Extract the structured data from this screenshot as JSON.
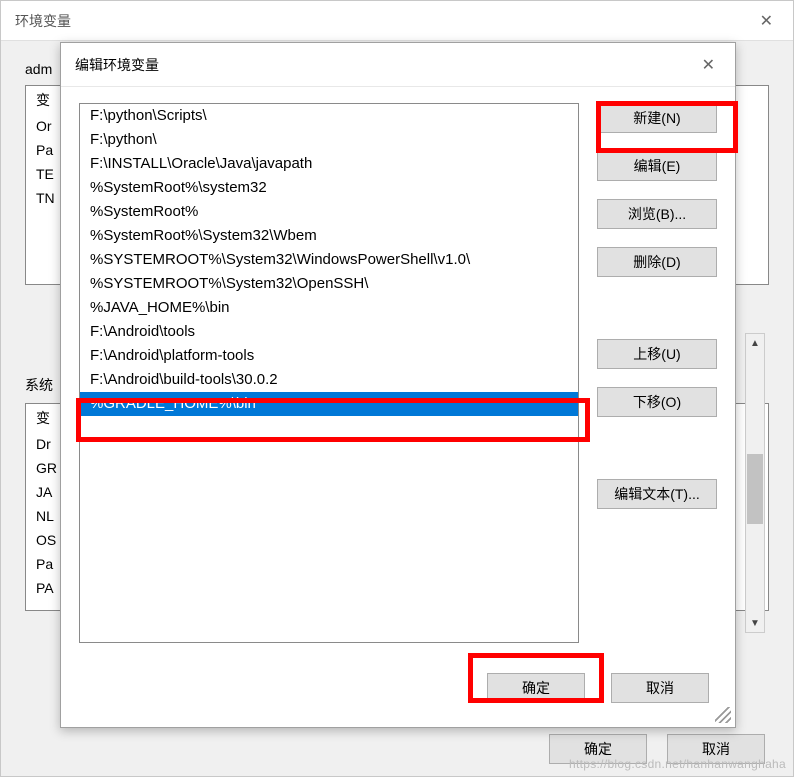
{
  "outer": {
    "title": "环境变量",
    "user_label": "adm",
    "sys_label": "系统",
    "user_vars_visible": [
      "变",
      "Or",
      "Pa",
      "TE",
      "TN"
    ],
    "sys_vars_visible": [
      "变",
      "Dr",
      "GR",
      "JA",
      "NL",
      "OS",
      "Pa",
      "PA",
      ""
    ],
    "ok": "确定",
    "cancel": "取消"
  },
  "inner": {
    "title": "编辑环境变量",
    "entries": [
      "F:\\python\\Scripts\\",
      "F:\\python\\",
      "F:\\INSTALL\\Oracle\\Java\\javapath",
      "%SystemRoot%\\system32",
      "%SystemRoot%",
      "%SystemRoot%\\System32\\Wbem",
      "%SYSTEMROOT%\\System32\\WindowsPowerShell\\v1.0\\",
      "%SYSTEMROOT%\\System32\\OpenSSH\\",
      "%JAVA_HOME%\\bin",
      "F:\\Android\\tools",
      "F:\\Android\\platform-tools",
      "F:\\Android\\build-tools\\30.0.2",
      "%GRADLE_HOME%\\bin"
    ],
    "selected_index": 12,
    "buttons": {
      "new": "新建(N)",
      "edit": "编辑(E)",
      "browse": "浏览(B)...",
      "delete": "删除(D)",
      "up": "上移(U)",
      "down": "下移(O)",
      "edit_text": "编辑文本(T)..."
    },
    "ok": "确定",
    "cancel": "取消"
  },
  "watermark": "https://blog.csdn.net/hanhanwanghaha"
}
